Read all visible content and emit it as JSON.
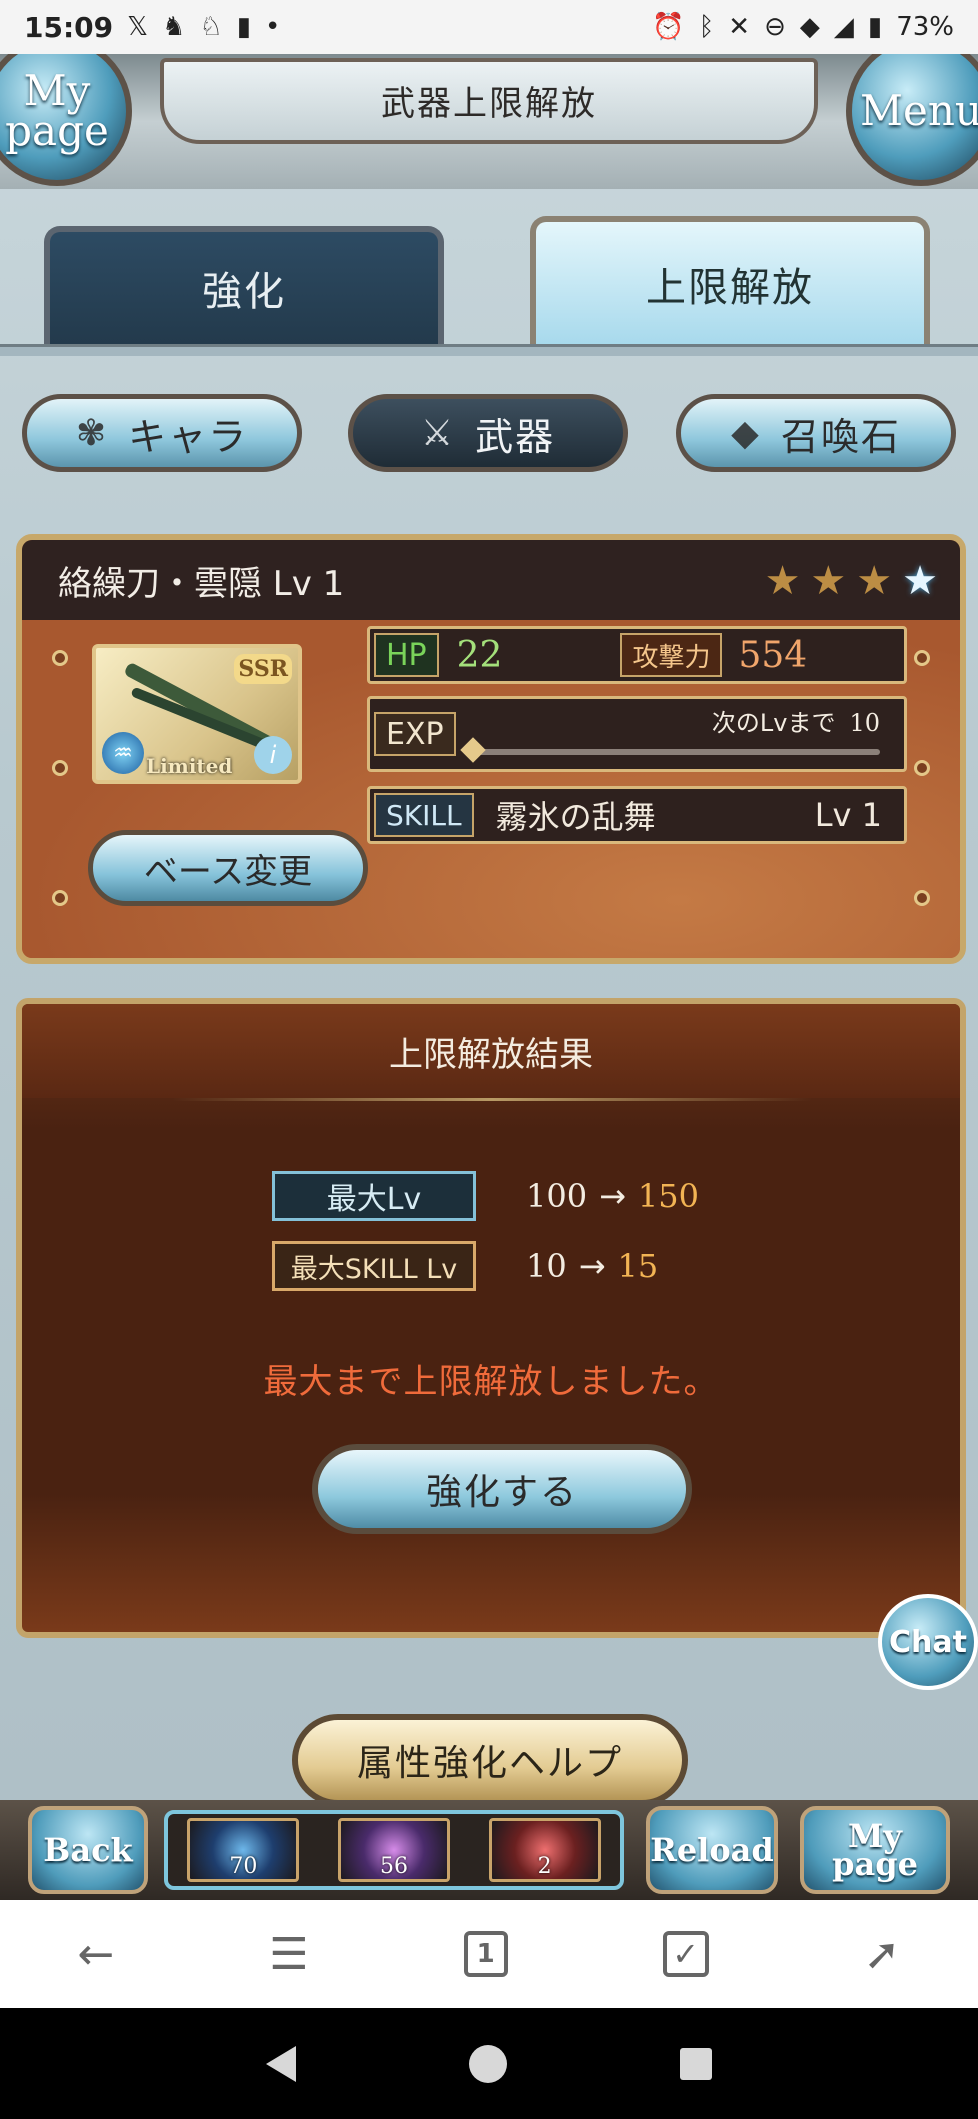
{
  "status_bar": {
    "time": "15:09",
    "battery": "73%",
    "left_icons": [
      "x-icon",
      "app-icon",
      "horse-icon",
      "app-icon",
      "dot-icon"
    ],
    "right_icons": [
      "alarm-icon",
      "bluetooth-icon",
      "mute-icon",
      "dnd-icon",
      "wifi-icon",
      "signal-icon",
      "battery-icon"
    ]
  },
  "header": {
    "title": "武器上限解放",
    "mypage_label": "My page",
    "menu_label": "Menu"
  },
  "tabs": [
    {
      "label": "強化",
      "active": false
    },
    {
      "label": "上限解放",
      "active": true
    }
  ],
  "categories": [
    {
      "label": "キャラ",
      "icon": "chara-icon",
      "selected": false
    },
    {
      "label": "武器",
      "icon": "swords-icon",
      "selected": true
    },
    {
      "label": "召喚石",
      "icon": "crystal-icon",
      "selected": false
    }
  ],
  "weapon": {
    "name": "絡繰刀・雲隠 Lv 1",
    "rarity": "SSR",
    "badge": "Limited",
    "stars_total": 4,
    "stars_blue": 1,
    "base_change_label": "ベース変更",
    "hp_label": "HP",
    "hp_value": "22",
    "atk_label": "攻撃力",
    "atk_value": "554",
    "exp_label": "EXP",
    "exp_next_label": "次のLvまで",
    "exp_next_value": "10",
    "exp_progress": 0.0,
    "skill_label": "SKILL",
    "skill_name": "霧氷の乱舞",
    "skill_level": "Lv 1"
  },
  "result": {
    "title": "上限解放結果",
    "rows": [
      {
        "label": "最大Lv",
        "old": "100",
        "arrow": "→",
        "new": "150"
      },
      {
        "label": "最大SKILL Lv",
        "old": "10",
        "arrow": "→",
        "new": "15"
      }
    ],
    "message": "最大まで上限解放しました。",
    "enhance_button": "強化する"
  },
  "chat_label": "Chat",
  "help_button": "属性強化ヘルプ",
  "game_nav": {
    "back_label": "Back",
    "reload_label": "Reload",
    "mypage_label": "My page",
    "stamina": [
      "70",
      "56",
      "2"
    ]
  },
  "browser_nav": {
    "tab_count": "1"
  },
  "colors": {
    "accent_blue": "#8ec9dd",
    "card_brown": "#b5673a",
    "result_brown": "#4a2211",
    "message_orange": "#f06b3b",
    "new_value_gold": "#f2b454"
  }
}
